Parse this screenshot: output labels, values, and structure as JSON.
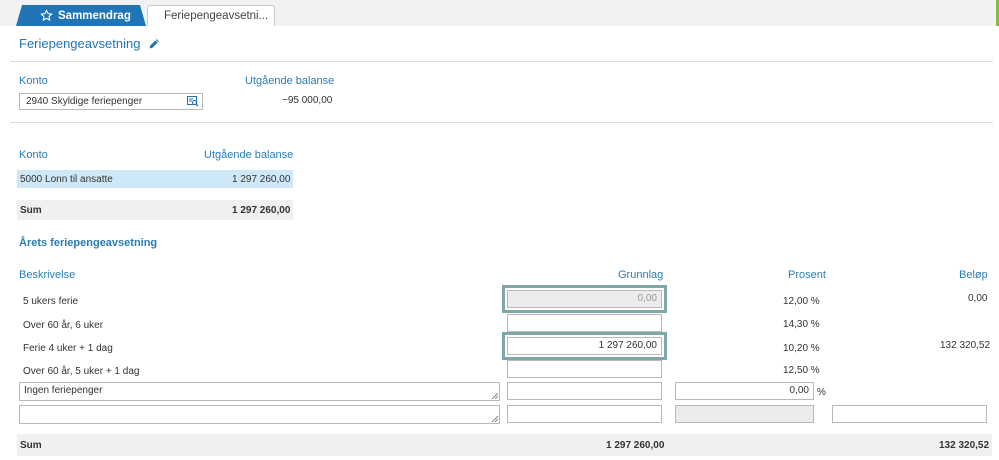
{
  "tabs": [
    {
      "label": "Sammendrag",
      "icon": "star-icon",
      "active": true
    },
    {
      "label": "Feriepengeavsetni...",
      "active": false
    }
  ],
  "page": {
    "title": "Feriepengeavsetning",
    "edit_icon": "pencil-icon"
  },
  "account_section": {
    "konto_label": "Konto",
    "balance_label": "Utgående balanse",
    "selected_account": "2940 Skyldige feriepenger",
    "balance_value": "−95 000,00"
  },
  "accounts_table": {
    "headers": [
      "Konto",
      "Utgående balanse"
    ],
    "rows": [
      {
        "konto": "5000 Lonn til ansatte",
        "balance": "1 297 260,00"
      }
    ],
    "sum_label": "Sum",
    "sum_value": "1 297 260,00"
  },
  "provision": {
    "section_title": "Årets feriepengeavsetning",
    "headers": {
      "description": "Beskrivelse",
      "basis": "Grunnlag",
      "percent": "Prosent",
      "amount": "Beløp"
    },
    "rows": [
      {
        "description": "5 ukers ferie",
        "basis": "0,00",
        "percent": "12,00 %",
        "amount": "0,00"
      },
      {
        "description": "Over 60 år, 6 uker",
        "basis": "",
        "percent": "14,30 %",
        "amount": ""
      },
      {
        "description": "Ferie 4 uker + 1 dag",
        "basis": "1 297 260,00",
        "percent": "10,20 %",
        "amount": "132 320,52"
      },
      {
        "description": "Over 60 år, 5 uker + 1 dag",
        "basis": "",
        "percent": "12,50 %",
        "amount": ""
      }
    ],
    "custom_row_1": {
      "description": "Ingen feriepenger",
      "basis": "",
      "percent": "0,00",
      "percent_unit": "%",
      "amount": ""
    },
    "custom_row_2": {
      "description": "",
      "basis": "",
      "percent": "",
      "amount": ""
    },
    "sum_label": "Sum",
    "sum_basis": "1 297 260,00",
    "sum_amount": "132 320,52"
  },
  "colors": {
    "accent": "#1f75b6",
    "row_highlight": "#cfe8f7",
    "focus_outline": "#7fa6a8",
    "top_edge": "#7bbf3a"
  }
}
